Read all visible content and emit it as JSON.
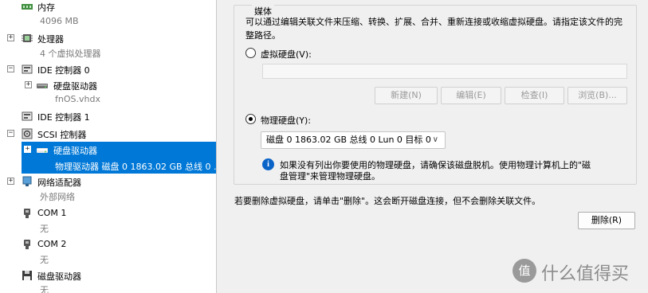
{
  "tree": {
    "memory": {
      "label": "内存",
      "sub": "4096 MB"
    },
    "processor": {
      "label": "处理器",
      "sub": "4 个虚拟处理器"
    },
    "ide0": {
      "label": "IDE 控制器 0"
    },
    "ide0_disk": {
      "label": "硬盘驱动器",
      "sub": "fnOS.vhdx"
    },
    "ide1": {
      "label": "IDE 控制器 1"
    },
    "scsi": {
      "label": "SCSI 控制器"
    },
    "scsi_disk": {
      "label": "硬盘驱动器",
      "sub": "物理驱动器 磁盘 0 1863.02 GB 总线 0 ..."
    },
    "network": {
      "label": "网络适配器",
      "sub": "外部网络"
    },
    "com1": {
      "label": "COM 1",
      "sub": "无"
    },
    "com2": {
      "label": "COM 2",
      "sub": "无"
    },
    "floppy": {
      "label": "磁盘驱动器",
      "sub": "无"
    }
  },
  "media": {
    "group_title": "媒体",
    "description_line1": "可以通过编辑关联文件来压缩、转换、扩展、合并、重新连接或收缩虚拟硬盘。请指定该文件的完",
    "description_line2": "整路径。",
    "virtual_disk_label": "虚拟硬盘(V):",
    "path_value": "",
    "buttons": {
      "new": "新建(N)",
      "edit": "编辑(E)",
      "inspect": "检查(I)",
      "browse": "浏览(B)..."
    },
    "physical_disk_label": "物理硬盘(Y):",
    "physical_disk_selected": "磁盘 0 1863.02 GB 总线 0 Lun 0 目标 0",
    "info_line1": "如果没有列出你要使用的物理硬盘，请确保该磁盘脱机。使用物理计算机上的\"磁",
    "info_line2": "盘管理\"来管理物理硬盘。"
  },
  "remove_hint": "若要删除虚拟硬盘，请单击\"删除\"。这会断开磁盘连接，但不会删除关联文件。",
  "remove_button": "删除(R)",
  "watermark": {
    "symbol": "值",
    "text": "什么值得买"
  }
}
